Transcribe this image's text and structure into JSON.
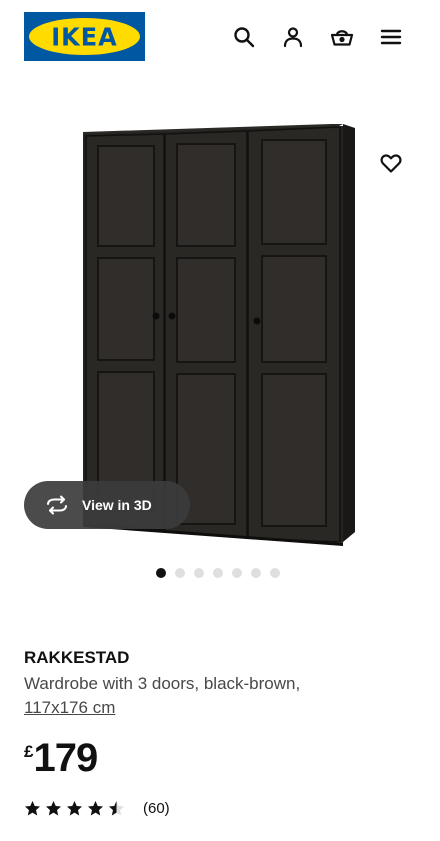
{
  "header": {
    "logo_text": "IKEA",
    "icons": [
      "search-icon",
      "account-icon",
      "basket-icon",
      "menu-icon"
    ]
  },
  "gallery": {
    "view_3d_label": "View in 3D",
    "image_count": 7,
    "active_image": 1
  },
  "product": {
    "name": "RAKKESTAD",
    "description": "Wardrobe with 3 doors, black-brown,",
    "size": "117x176 cm",
    "currency": "£",
    "price": "179",
    "rating_value": 4.5,
    "rating_max": 5,
    "review_count": "(60)"
  },
  "colors": {
    "ikea_blue": "#0058a3",
    "ikea_yellow": "#ffdb00",
    "text": "#111111",
    "secondary_text": "#484848"
  }
}
